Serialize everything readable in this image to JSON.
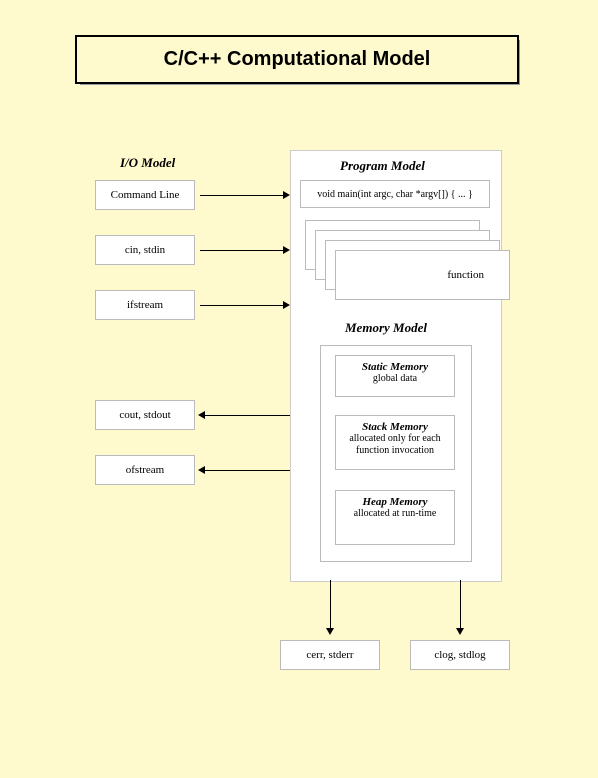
{
  "title": "C/C++ Computational Model",
  "io_label": "I/O Model",
  "program_label": "Program Model",
  "memory_label": "Memory Model",
  "io_boxes": {
    "cmd": "Command Line",
    "cin": "cin, stdin",
    "ifs": "ifstream",
    "cout": "cout, stdout",
    "ofs": "ofstream"
  },
  "main_sig": "void main(int argc, char *argv[]) { ... }",
  "func_label": "function",
  "memory": {
    "static_h": "Static Memory",
    "static_b": "global data",
    "stack_h": "Stack Memory",
    "stack_b": "allocated only for each function invocation",
    "heap_h": "Heap Memory",
    "heap_b": "allocated at run-time"
  },
  "out_boxes": {
    "cerr": "cerr, stderr",
    "clog": "clog, stdlog"
  }
}
